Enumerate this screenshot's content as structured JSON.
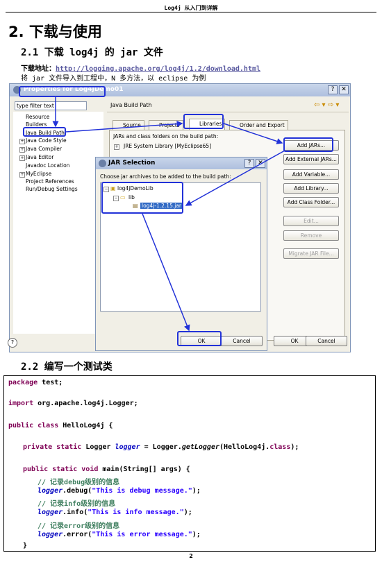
{
  "header": {
    "title": "Log4j 从入门到详解"
  },
  "section": {
    "heading": "2. 下载与使用"
  },
  "sub1": {
    "heading": "2.1 下载 log4j 的 jar 文件"
  },
  "download": {
    "label": "下载地址：",
    "url": "http://logging.apache.org/log4j/1.2/download.html"
  },
  "import_note": "将 jar 文件导入到工程中，N 多方法，以 eclipse 为例",
  "dialog": {
    "title": "Properties for Log4JDemo01",
    "filter_placeholder": "type filter text",
    "tree": [
      "Resource",
      "Builders",
      "Java Build Path",
      "Java Code Style",
      "Java Compiler",
      "Java Editor",
      "Javadoc Location",
      "MyEclipse",
      "Project References",
      "Run/Debug Settings"
    ],
    "page_title": "Java Build Path",
    "tabs": [
      "Source",
      "Projects",
      "Libraries",
      "Order and Export"
    ],
    "jars_label": "JARs and class folders on the build path:",
    "jre_entry": "JRE System Library [MyEclipse65]",
    "buttons": [
      "Add JARs...",
      "Add External JARs...",
      "Add Variable...",
      "Add Library...",
      "Add Class Folder...",
      "Edit...",
      "Remove",
      "Migrate JAR File..."
    ],
    "ok": "OK",
    "cancel": "Cancel",
    "help": "?"
  },
  "jar_dialog": {
    "title": "JAR Selection",
    "prompt": "Choose jar archives to be added to the build path:",
    "tree": [
      "log4jDemoLib",
      "lib",
      "log4j-1.2.15.jar"
    ],
    "ok": "OK",
    "cancel": "Cancel"
  },
  "sub2": {
    "heading": "2.2 编写一个测试类"
  },
  "code": {
    "l1a": "package",
    "l1b": " test;",
    "l2a": "import",
    "l2b": " org.apache.log4j.Logger;",
    "l3a": "public class",
    "l3b": " HelloLog4j {",
    "l4a": "private static",
    "l4b": " Logger ",
    "l4c": "logger",
    "l4d": " = Logger.",
    "l4e": "getLogger",
    "l4f": "(HelloLog4j.",
    "l4g": "class",
    "l4h": ");",
    "l5a": "public static void",
    "l5b": " main(String[] args) {",
    "c1": "// 记录debug级别的信息",
    "l6a": "logger",
    "l6b": ".debug(",
    "l6c": "\"This is debug message.\"",
    "l6d": ");",
    "c2": "// 记录info级别的信息",
    "l7a": "logger",
    "l7b": ".info(",
    "l7c": "\"This is info message.\"",
    "l7d": ");",
    "c3": "// 记录error级别的信息",
    "l8a": "logger",
    "l8b": ".error(",
    "l8c": "\"This is error message.\"",
    "l8d": ");",
    "close": "}"
  },
  "page_number": "2",
  "colors": {
    "highlight": "#2232d8",
    "keyword": "#7f0055",
    "string": "#2a00ff",
    "comment": "#3f7f5f",
    "field": "#0000c0"
  }
}
